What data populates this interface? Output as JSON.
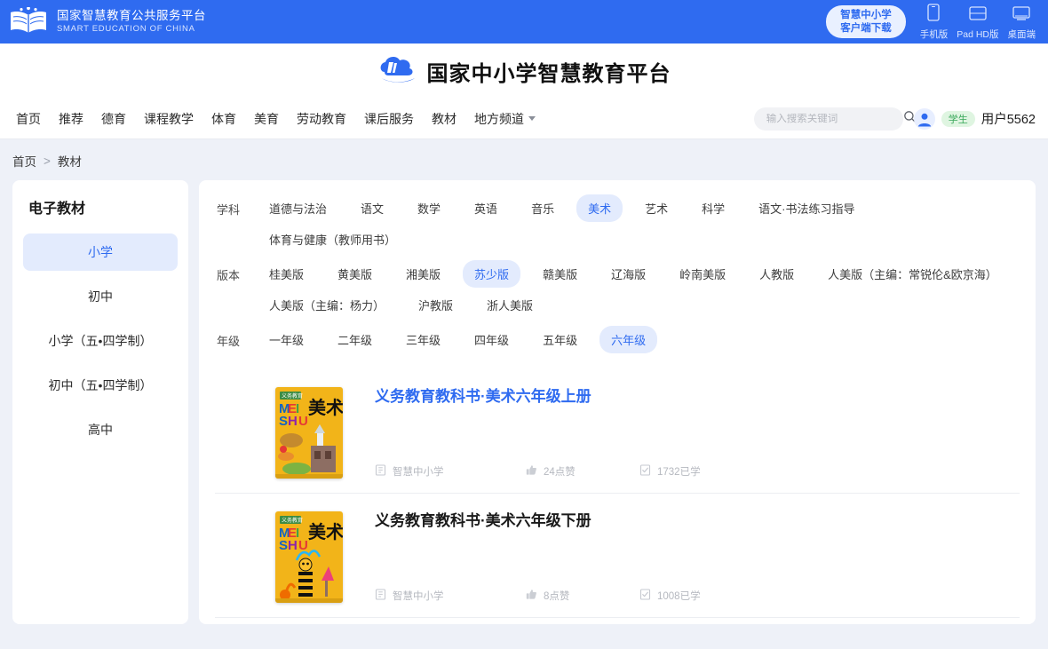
{
  "topbar": {
    "brand_cn": "国家智慧教育公共服务平台",
    "brand_en": "SMART EDUCATION OF CHINA",
    "client_button_line1": "智慧中小学",
    "client_button_line2": "客户端下载",
    "devices": [
      {
        "label": "手机版",
        "icon": "phone-icon"
      },
      {
        "label": "Pad HD版",
        "icon": "tablet-icon"
      },
      {
        "label": "桌面端",
        "icon": "desktop-icon"
      }
    ]
  },
  "site": {
    "title": "国家中小学智慧教育平台",
    "logo_icon": "cloud-logo-icon"
  },
  "nav": {
    "items": [
      {
        "label": "首页"
      },
      {
        "label": "推荐"
      },
      {
        "label": "德育"
      },
      {
        "label": "课程教学"
      },
      {
        "label": "体育"
      },
      {
        "label": "美育"
      },
      {
        "label": "劳动教育"
      },
      {
        "label": "课后服务"
      },
      {
        "label": "教材"
      },
      {
        "label": "地方频道",
        "caret": true
      }
    ]
  },
  "search": {
    "placeholder": "输入搜索关键词",
    "value": "",
    "icon": "search-icon"
  },
  "user": {
    "role_badge": "学生",
    "name": "用户5562",
    "avatar_icon": "user-avatar-icon"
  },
  "breadcrumb": {
    "home": "首页",
    "separator": ">",
    "current": "教材"
  },
  "sidebar": {
    "title": "电子教材",
    "items": [
      {
        "label": "小学",
        "active": true
      },
      {
        "label": "初中",
        "active": false
      },
      {
        "label": "小学（五•四学制）",
        "active": false
      },
      {
        "label": "初中（五•四学制）",
        "active": false
      },
      {
        "label": "高中",
        "active": false
      }
    ]
  },
  "filters": [
    {
      "label": "学科",
      "chips": [
        {
          "label": "道德与法治",
          "active": false
        },
        {
          "label": "语文",
          "active": false
        },
        {
          "label": "数学",
          "active": false
        },
        {
          "label": "英语",
          "active": false
        },
        {
          "label": "音乐",
          "active": false
        },
        {
          "label": "美术",
          "active": true
        },
        {
          "label": "艺术",
          "active": false
        },
        {
          "label": "科学",
          "active": false
        },
        {
          "label": "语文·书法练习指导",
          "active": false
        },
        {
          "label": "体育与健康（教师用书）",
          "active": false
        }
      ]
    },
    {
      "label": "版本",
      "chips": [
        {
          "label": "桂美版",
          "active": false
        },
        {
          "label": "黄美版",
          "active": false
        },
        {
          "label": "湘美版",
          "active": false
        },
        {
          "label": "苏少版",
          "active": true
        },
        {
          "label": "赣美版",
          "active": false
        },
        {
          "label": "辽海版",
          "active": false
        },
        {
          "label": "岭南美版",
          "active": false
        },
        {
          "label": "人教版",
          "active": false
        },
        {
          "label": "人美版（主编：常锐伦&欧京海）",
          "active": false
        },
        {
          "label": "人美版（主编：杨力）",
          "active": false
        },
        {
          "label": "沪教版",
          "active": false
        },
        {
          "label": "浙人美版",
          "active": false
        }
      ]
    },
    {
      "label": "年级",
      "chips": [
        {
          "label": "一年级",
          "active": false
        },
        {
          "label": "二年级",
          "active": false
        },
        {
          "label": "三年级",
          "active": false
        },
        {
          "label": "四年级",
          "active": false
        },
        {
          "label": "五年级",
          "active": false
        },
        {
          "label": "六年级",
          "active": true
        }
      ]
    }
  ],
  "books": [
    {
      "title": "义务教育教科书·美术六年级上册",
      "title_is_link": true,
      "publisher": "智慧中小学",
      "likes": "24点赞",
      "learned": "1732已学",
      "cover_title": "美术",
      "cover_pinyin_1": "MEI",
      "cover_pinyin_2": "SHU",
      "cover_bg": "#f2b419"
    },
    {
      "title": "义务教育教科书·美术六年级下册",
      "title_is_link": false,
      "publisher": "智慧中小学",
      "likes": "8点赞",
      "learned": "1008已学",
      "cover_title": "美术",
      "cover_pinyin_1": "MEI",
      "cover_pinyin_2": "SHU",
      "cover_bg": "#f2b419"
    }
  ],
  "meta_icons": {
    "publisher": "book-icon",
    "likes": "thumbs-up-icon",
    "learned": "learned-icon"
  },
  "colors": {
    "brand_blue": "#2f6bf0",
    "page_bg": "#eef1f8",
    "chip_active_bg": "#e3ebfd",
    "badge_green": "#39a85a"
  }
}
